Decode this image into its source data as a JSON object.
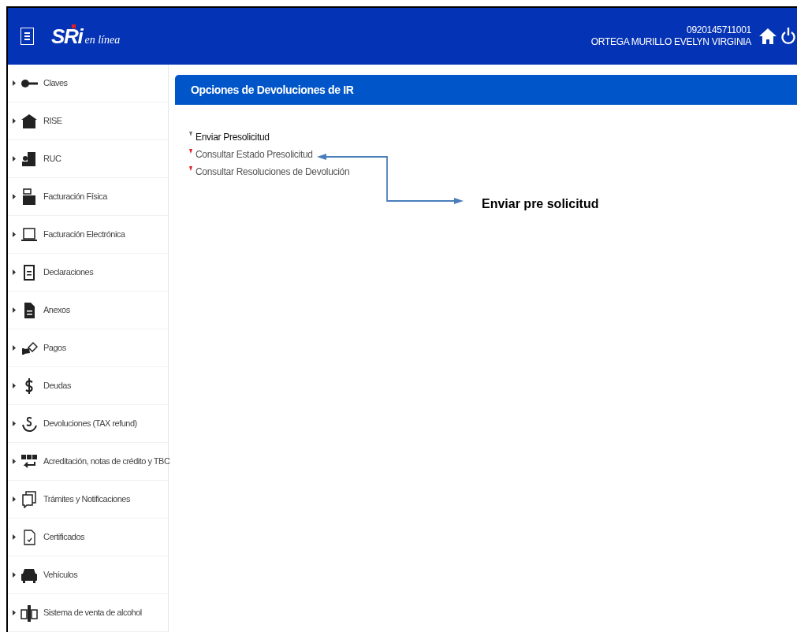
{
  "header": {
    "logo_main": "SRi",
    "logo_sub": "en línea",
    "user_id": "0920145711001",
    "user_name": "ORTEGA MURILLO EVELYN VIRGINIA"
  },
  "sidebar": {
    "items": [
      {
        "label": "Claves"
      },
      {
        "label": "RISE"
      },
      {
        "label": "RUC"
      },
      {
        "label": "Facturación Física"
      },
      {
        "label": "Facturación Electrónica"
      },
      {
        "label": "Declaraciones"
      },
      {
        "label": "Anexos"
      },
      {
        "label": "Pagos"
      },
      {
        "label": "Deudas"
      },
      {
        "label": "Devoluciones (TAX refund)"
      },
      {
        "label": "Acreditación, notas de crédito y TBC"
      },
      {
        "label": "Trámites y Notificaciones"
      },
      {
        "label": "Certificados"
      },
      {
        "label": "Vehículos"
      },
      {
        "label": "Sistema de venta de alcohol"
      }
    ]
  },
  "panel": {
    "title": "Opciones de Devoluciones de IR",
    "options": [
      {
        "label": "Enviar Presolicitud",
        "selected": true
      },
      {
        "label": "Consultar Estado Presolicitud",
        "selected": false
      },
      {
        "label": "Consultar Resoluciones de Devolución",
        "selected": false
      }
    ]
  },
  "annotation": {
    "text": "Enviar pre solicitud"
  }
}
